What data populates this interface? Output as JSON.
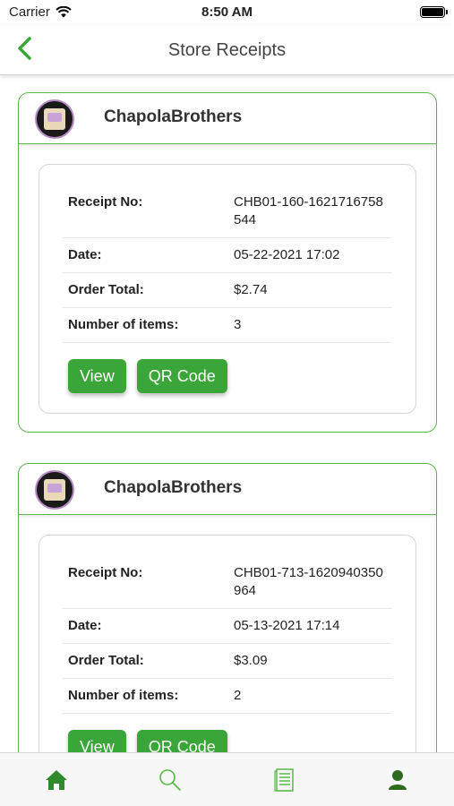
{
  "status_bar": {
    "carrier": "Carrier",
    "time": "8:50 AM"
  },
  "nav": {
    "title": "Store Receipts"
  },
  "colors": {
    "accent": "#3aa538",
    "border": "#5bb84a",
    "tab_active": "#2f8a2c"
  },
  "receipts": [
    {
      "store_name": "ChapolaBrothers",
      "receipt_label": "Receipt No:",
      "receipt_no": "CHB01-160-1621716758544",
      "date_label": "Date:",
      "date": "05-22-2021 17:02",
      "total_label": "Order Total:",
      "total": "$2.74",
      "items_label": "Number of items:",
      "items": "3",
      "view_label": "View",
      "qr_label": "QR Code"
    },
    {
      "store_name": "ChapolaBrothers",
      "receipt_label": "Receipt No:",
      "receipt_no": "CHB01-713-1620940350964",
      "date_label": "Date:",
      "date": "05-13-2021 17:14",
      "total_label": "Order Total:",
      "total": "$3.09",
      "items_label": "Number of items:",
      "items": "2",
      "view_label": "View",
      "qr_label": "QR Code"
    }
  ],
  "tabs": [
    {
      "icon": "home-icon"
    },
    {
      "icon": "search-icon"
    },
    {
      "icon": "receipts-icon"
    },
    {
      "icon": "profile-icon"
    }
  ]
}
